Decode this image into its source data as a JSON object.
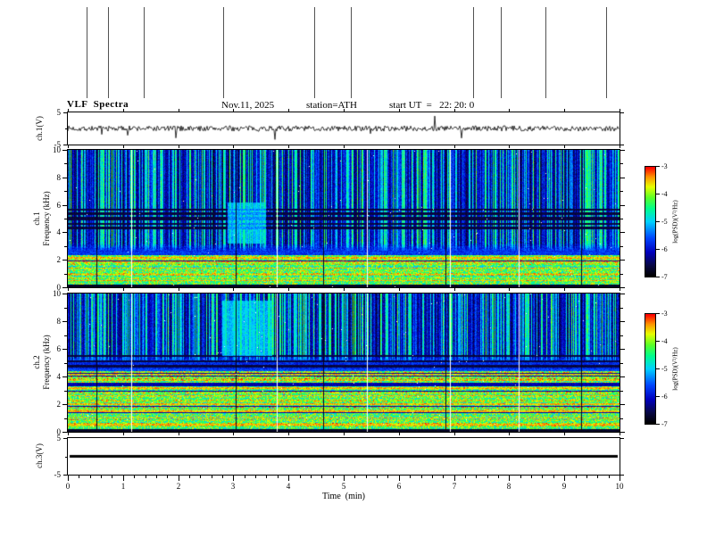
{
  "header": {
    "title": "VLF  Spectra",
    "date": "Nov.11, 2025",
    "station": "station=ATH",
    "start_ut": "start UT  =   22: 20: 0"
  },
  "labels": {
    "ch1_v": "ch.1(V)",
    "ch3_v": "ch.3(V)",
    "ch1": "ch.1",
    "ch2": "ch.2",
    "freq": "Frequency (kHz)",
    "x_axis": "Time  (min)"
  },
  "axes": {
    "x": {
      "min": 0,
      "max": 10,
      "major_ticks": [
        0,
        1,
        2,
        3,
        4,
        5,
        6,
        7,
        8,
        9,
        10
      ],
      "minor_step": 0.2
    },
    "spec_y": {
      "min": 0,
      "max": 10,
      "major_ticks": [
        0,
        2,
        4,
        6,
        8,
        10
      ],
      "minor_ticks": [
        1,
        3,
        5,
        7,
        9
      ]
    },
    "volt_y": {
      "min": -5,
      "max": 5,
      "labeled_ticks": [
        5,
        -5
      ]
    }
  },
  "colorbar": {
    "label": "log(PSD)(V²/Hz)",
    "min": -7,
    "max": -3,
    "ticks": [
      -3,
      -4,
      -5,
      -6,
      -7
    ]
  },
  "artifacts": {
    "top_vertical_lines_x_min": [
      0.34,
      0.73,
      1.37,
      2.82,
      4.47,
      5.13,
      7.34,
      7.84,
      8.66,
      9.76
    ]
  },
  "chart_data": [
    {
      "type": "line",
      "name": "ch1_waveform",
      "ylabel": "ch.1(V)",
      "xlabel": "Time (min)",
      "xlim": [
        0,
        10
      ],
      "ylim": [
        -5,
        5
      ],
      "description": "Broadband noise around 0 V (about ±1.5 V) with sparse impulsive spikes reaching about ±4 V",
      "synth": {
        "seed": 7,
        "noise_amp": 0.85,
        "spike_prob": 0.014,
        "spike_amp_min": 1.5,
        "spike_amp_max": 4.2
      }
    },
    {
      "type": "heatmap",
      "name": "ch1_spectrogram",
      "ylabel": "ch.1 Frequency (kHz)",
      "xlim": [
        0,
        10
      ],
      "ylim": [
        0,
        10
      ],
      "zlabel": "log(PSD)(V²/Hz)",
      "zlim": [
        -7,
        -3
      ],
      "description": "VLF spectrogram: bright horizontal PSD bands below ~2.4 kHz, black band below ~0.2 kHz, dense vertical sferic streaks above ~2.6 kHz, dark horizontal absorption bands near 4.3-5.7 kHz, lighter cyan patch near 3.0-3.6 min",
      "synth": {
        "seed": 101,
        "low_band_top": 2.35,
        "streak_fmin": 2.6,
        "bright_lines_khz": [
          0.5,
          0.95,
          1.4,
          1.85,
          2.15
        ],
        "dark_bands_khz": [
          [
            4.3,
            0.1
          ],
          [
            4.6,
            0.08
          ],
          [
            5.0,
            0.11
          ],
          [
            5.35,
            0.08
          ],
          [
            5.65,
            0.06
          ]
        ],
        "bright_patch": {
          "x0": 2.9,
          "x1": 3.6,
          "f0": 3.2,
          "f1": 6.2
        },
        "white_cols_min": [
          1.15,
          3.78,
          5.42,
          6.92,
          8.17
        ],
        "dark_cols_min": [
          0.52,
          3.05,
          4.63,
          6.85,
          9.3
        ]
      }
    },
    {
      "type": "heatmap",
      "name": "ch2_spectrogram",
      "ylabel": "ch.2 Frequency (kHz)",
      "xlim": [
        0,
        10
      ],
      "ylim": [
        0,
        10
      ],
      "zlabel": "log(PSD)(V²/Hz)",
      "zlim": [
        -7,
        -3
      ],
      "description": "VLF spectrogram: bright horizontal PSD bands up to ~4.4 kHz, black band below ~0.2 kHz, dense vertical sferic streaks above ~5 kHz, lighter cyan patch near 2.8-3.7 min",
      "synth": {
        "seed": 202,
        "low_band_top": 4.4,
        "streak_fmin": 5.0,
        "bright_lines_khz": [
          0.5,
          1.0,
          1.5,
          2.0,
          2.6,
          3.15,
          3.7,
          4.15
        ],
        "dark_bands_khz": [
          [
            4.75,
            0.08
          ],
          [
            5.1,
            0.09
          ],
          [
            5.5,
            0.07
          ]
        ],
        "bright_patch": {
          "x0": 2.8,
          "x1": 3.7,
          "f0": 5.5,
          "f1": 9.5
        },
        "white_cols_min": [
          1.15,
          3.78,
          5.42,
          6.92,
          8.17
        ],
        "dark_cols_min": [
          0.52,
          3.05,
          4.63,
          6.85,
          9.3
        ]
      }
    },
    {
      "type": "line",
      "name": "ch3_waveform",
      "ylabel": "ch.3(V)",
      "xlabel": "Time (min)",
      "xlim": [
        0,
        10
      ],
      "ylim": [
        -5,
        5
      ],
      "description": "Flat thick line at 0 V (channel inactive)",
      "synth": {
        "value": 0
      }
    }
  ]
}
